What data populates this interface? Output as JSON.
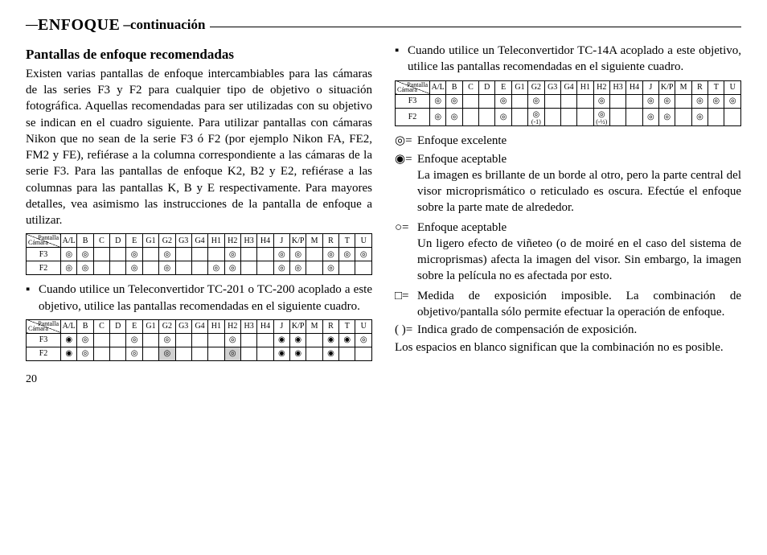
{
  "header": {
    "title": "ENFOQUE",
    "cont": "–continuación"
  },
  "left": {
    "subtitle": "Pantallas de enfoque recomendadas",
    "intro": "Existen varias pantallas de enfoque intercambiables para las cámaras de las series F3 y F2 para cualquier tipo de objetivo o situación fotográfica. Aquellas recomendadas para ser utilizadas con su objetivo se indican en el cuadro siguiente. Para utilizar pantallas con cámaras Nikon que no sean de la serie F3 ó F2 (por ejemplo Nikon FA, FE2, FM2 y FE), refiérase a la columna correspondiente a las cámaras de la serie F3. Para las pantallas de enfoque K2, B2 y E2, refiérase a las columnas para las pantallas K, B y E respectivamente. Para mayores detalles, vea asimismo las instrucciones de la pantalla de enfoque a utilizar.",
    "bullet1": "Cuando utilice un Teleconvertidor TC-201 o TC-200 acoplado a este objetivo, utilice las pantallas recomendadas en el siguiente cuadro.",
    "page": "20"
  },
  "right": {
    "bullet2": "Cuando utilice un Teleconvertidor TC-14A acoplado a este objetivo, utilice las pantallas recomendadas en el siguiente cuadro.",
    "legend": {
      "excellent": {
        "sym": "◎=",
        "txt": "Enfoque excelente"
      },
      "accept1": {
        "sym": "◉=",
        "txt": "Enfoque aceptable",
        "desc": "La imagen es brillante de un borde al otro, pero la parte central del visor microprismático o reticulado es oscura. Efectúe el enfoque sobre la parte mate de alrededor."
      },
      "accept2": {
        "sym": "○=",
        "txt": "Enfoque aceptable",
        "desc": "Un ligero efecto de viñeteo (o de moiré en el caso del sistema de microprismas) afecta la imagen del visor. Sin embargo, la imagen sobre la película no es afectada por esto."
      },
      "impossible": {
        "sym": "□=",
        "txt": "Medida de exposición imposible. La combinación de objetivo/pantalla sólo permite efectuar la operación de enfoque."
      },
      "comp": {
        "sym": "( )=",
        "txt": "Indica grado de compensación de exposición."
      },
      "blank": "Los espacios en blanco significan que la combinación no es posible."
    }
  },
  "corner": {
    "cam": "Cámara",
    "pan": "Pantalla"
  },
  "headers": [
    "A/L",
    "B",
    "C",
    "D",
    "E",
    "G1",
    "G2",
    "G3",
    "G4",
    "H1",
    "H2",
    "H3",
    "H4",
    "J",
    "K/P",
    "M",
    "R",
    "T",
    "U"
  ],
  "table1": {
    "F3": {
      "label": "F3",
      "cells": [
        "◎",
        "◎",
        "",
        "",
        "◎",
        "",
        "◎",
        "",
        "",
        "",
        "◎",
        "",
        "",
        "◎",
        "◎",
        "",
        "◎",
        "◎",
        "◎"
      ]
    },
    "F2": {
      "label": "F2",
      "cells": [
        "◎",
        "◎",
        "",
        "",
        "◎",
        "",
        "◎",
        "",
        "",
        "◎",
        "◎",
        "",
        "",
        "◎",
        "◎",
        "",
        "◎",
        "",
        ""
      ]
    }
  },
  "table2": {
    "F3": {
      "label": "F3",
      "cells": [
        "◉",
        "◎",
        "",
        "",
        "◎",
        "",
        "◎",
        "",
        "",
        "",
        "◎",
        "",
        "",
        "◉",
        "◉",
        "",
        "◉",
        "◉",
        "◎"
      ]
    },
    "F2": {
      "label": "F2",
      "cells": [
        "◉",
        "◎",
        "",
        "",
        "◎",
        "",
        "◎",
        "",
        "",
        "",
        "◎",
        "",
        "",
        "◉",
        "◉",
        "",
        "◉",
        "",
        ""
      ]
    },
    "shadeG2_F2": true,
    "shadeH2_F2": true
  },
  "table3": {
    "F3": {
      "label": "F3",
      "cells": [
        "◎",
        "◎",
        "",
        "",
        "◎",
        "",
        "◎",
        "",
        "",
        "",
        "◎",
        "",
        "",
        "◎",
        "◎",
        "",
        "◎",
        "◎",
        "◎"
      ]
    },
    "F2": {
      "label": "F2",
      "cells": [
        "◎",
        "◎",
        "",
        "",
        "◎",
        "",
        "◎",
        "",
        "",
        "",
        "◎",
        "",
        "",
        "◎",
        "◎",
        "",
        "◎",
        "",
        ""
      ]
    },
    "subG2_F2": "(-1)",
    "subH2_F2": "(-½)"
  }
}
